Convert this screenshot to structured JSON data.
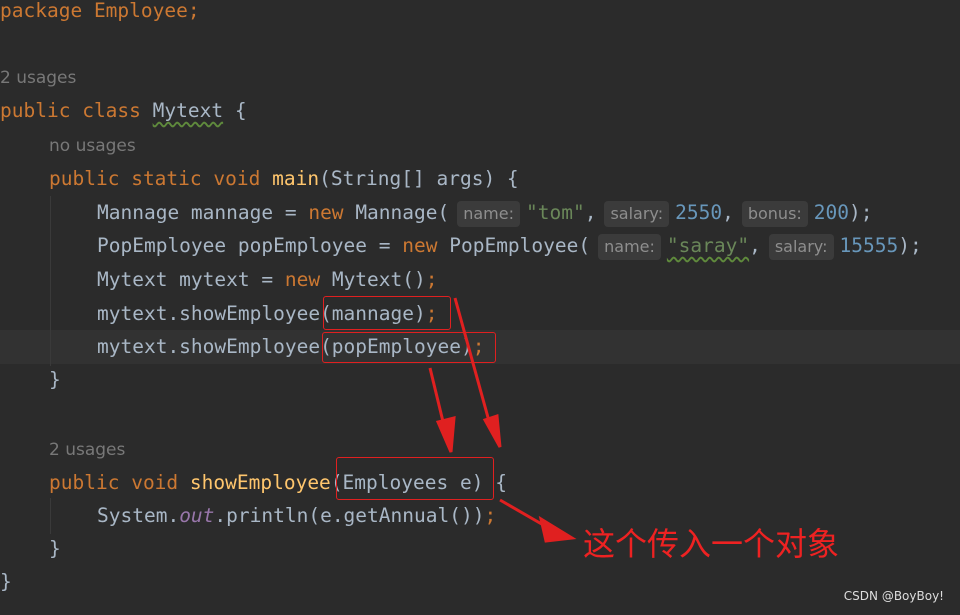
{
  "code": {
    "package_kw": "package",
    "package_name": "Employee;",
    "usages_class": "2 usages",
    "public_kw": "public",
    "class_kw": "class",
    "class_name": "Mytext",
    "open_brace": "{",
    "close_brace": "}",
    "no_usages": "no usages",
    "static_kw": "static",
    "void_kw": "void",
    "main_name": "main",
    "main_params": "(String[] args) {",
    "line1_decl": "Mannage mannage = ",
    "new_kw": "new",
    "mannage_ctor": "Mannage(",
    "hint_name": "name:",
    "str_tom": "\"tom\"",
    "comma": ",",
    "hint_salary": "salary:",
    "num_2550": "2550",
    "hint_bonus": "bonus:",
    "num_200": "200",
    "ctor_end": ");",
    "line2_decl": "PopEmployee popEmployee = ",
    "pop_ctor": "PopEmployee(",
    "str_saray": "\"saray\"",
    "num_15555": "15555",
    "line3_decl": "Mytext mytext = ",
    "mytext_ctor": "Mytext()",
    "semi": ";",
    "call_prefix": "mytext.showEmployee",
    "arg_mannage": "(mannage)",
    "arg_pop": "(popEmployee)",
    "usages_method": "2 usages",
    "show_name": "showEmployee",
    "show_params": "(Employees e)",
    "system_prefix": "System.",
    "out_field": "out",
    "println_call": ".println(e.getAnnual())"
  },
  "annotation": "这个传入一个对象",
  "watermark": "CSDN @BoyBoy!",
  "colors": {
    "background": "#2b2b2b",
    "keyword": "#cc7832",
    "method": "#ffc66d",
    "string": "#6a8759",
    "number": "#6897bb",
    "annotation_red": "#ee2222"
  }
}
